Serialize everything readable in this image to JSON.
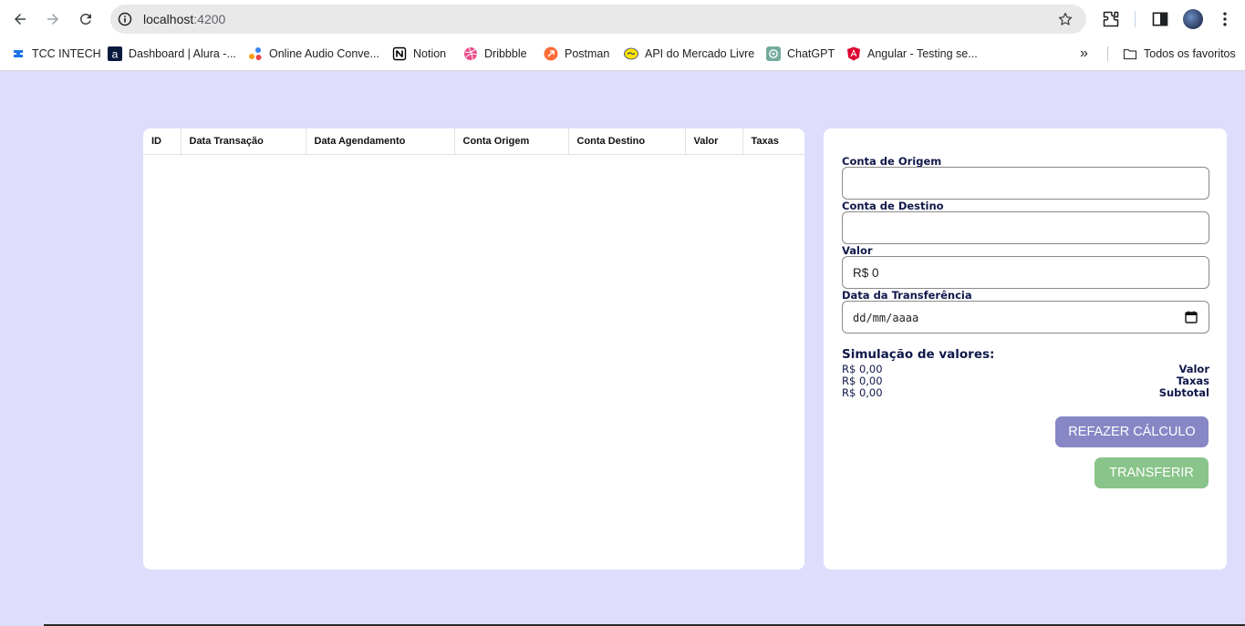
{
  "browser": {
    "url_host": "localhost",
    "url_port": ":4200",
    "bookmarks": [
      {
        "label": "TCC INTECH",
        "icon": "tcc-intech-icon",
        "color": "#1a73e8"
      },
      {
        "label": "Dashboard | Alura -...",
        "icon": "alura-icon",
        "color": "#0a1a3c"
      },
      {
        "label": "Online Audio Conve...",
        "icon": "audio-converter-icon",
        "color": "#3b82f6"
      },
      {
        "label": "Notion",
        "icon": "notion-icon",
        "color": "#000000"
      },
      {
        "label": "Dribbble",
        "icon": "dribbble-icon",
        "color": "#ea4c89"
      },
      {
        "label": "Postman",
        "icon": "postman-icon",
        "color": "#ff6c37"
      },
      {
        "label": "API do Mercado Livre",
        "icon": "mercado-livre-icon",
        "color": "#ffe600"
      },
      {
        "label": "ChatGPT",
        "icon": "chatgpt-icon",
        "color": "#74aa9c"
      },
      {
        "label": "Angular - Testing se...",
        "icon": "angular-icon",
        "color": "#dd0031"
      }
    ],
    "more_bookmarks": "»",
    "all_favorites": "Todos os favoritos"
  },
  "table": {
    "columns": [
      "ID",
      "Data Transação",
      "Data Agendamento",
      "Conta Origem",
      "Conta Destino",
      "Valor",
      "Taxas"
    ],
    "rows": []
  },
  "form": {
    "origin_label": "Conta de Origem",
    "origin_value": "",
    "destination_label": "Conta de Destino",
    "destination_value": "",
    "value_label": "Valor",
    "value_value": "R$ 0",
    "date_label": "Data da Transferência",
    "date_placeholder": "dd/mm/aaaa"
  },
  "simulation": {
    "title": "Simulação de valores:",
    "rows": [
      {
        "amount": "R$ 0,00",
        "label": "Valor"
      },
      {
        "amount": "R$ 0,00",
        "label": "Taxas"
      },
      {
        "amount": "R$ 0,00",
        "label": "Subtotal"
      }
    ]
  },
  "buttons": {
    "recalculate": "REFAZER CÁLCULO",
    "transfer": "TRANSFERIR"
  }
}
